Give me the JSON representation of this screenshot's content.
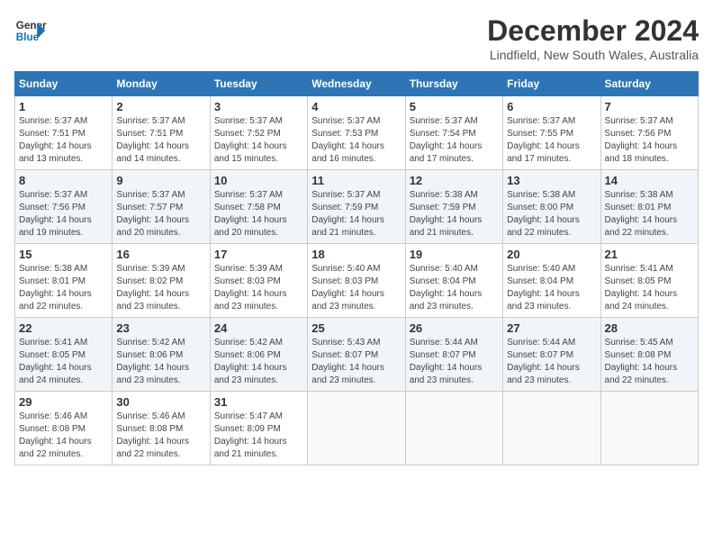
{
  "logo": {
    "line1": "General",
    "line2": "Blue"
  },
  "title": "December 2024",
  "subtitle": "Lindfield, New South Wales, Australia",
  "weekdays": [
    "Sunday",
    "Monday",
    "Tuesday",
    "Wednesday",
    "Thursday",
    "Friday",
    "Saturday"
  ],
  "weeks": [
    [
      {
        "day": "1",
        "sunrise": "5:37 AM",
        "sunset": "7:51 PM",
        "daylight": "14 hours and 13 minutes."
      },
      {
        "day": "2",
        "sunrise": "5:37 AM",
        "sunset": "7:51 PM",
        "daylight": "14 hours and 14 minutes."
      },
      {
        "day": "3",
        "sunrise": "5:37 AM",
        "sunset": "7:52 PM",
        "daylight": "14 hours and 15 minutes."
      },
      {
        "day": "4",
        "sunrise": "5:37 AM",
        "sunset": "7:53 PM",
        "daylight": "14 hours and 16 minutes."
      },
      {
        "day": "5",
        "sunrise": "5:37 AM",
        "sunset": "7:54 PM",
        "daylight": "14 hours and 17 minutes."
      },
      {
        "day": "6",
        "sunrise": "5:37 AM",
        "sunset": "7:55 PM",
        "daylight": "14 hours and 17 minutes."
      },
      {
        "day": "7",
        "sunrise": "5:37 AM",
        "sunset": "7:56 PM",
        "daylight": "14 hours and 18 minutes."
      }
    ],
    [
      {
        "day": "8",
        "sunrise": "5:37 AM",
        "sunset": "7:56 PM",
        "daylight": "14 hours and 19 minutes."
      },
      {
        "day": "9",
        "sunrise": "5:37 AM",
        "sunset": "7:57 PM",
        "daylight": "14 hours and 20 minutes."
      },
      {
        "day": "10",
        "sunrise": "5:37 AM",
        "sunset": "7:58 PM",
        "daylight": "14 hours and 20 minutes."
      },
      {
        "day": "11",
        "sunrise": "5:37 AM",
        "sunset": "7:59 PM",
        "daylight": "14 hours and 21 minutes."
      },
      {
        "day": "12",
        "sunrise": "5:38 AM",
        "sunset": "7:59 PM",
        "daylight": "14 hours and 21 minutes."
      },
      {
        "day": "13",
        "sunrise": "5:38 AM",
        "sunset": "8:00 PM",
        "daylight": "14 hours and 22 minutes."
      },
      {
        "day": "14",
        "sunrise": "5:38 AM",
        "sunset": "8:01 PM",
        "daylight": "14 hours and 22 minutes."
      }
    ],
    [
      {
        "day": "15",
        "sunrise": "5:38 AM",
        "sunset": "8:01 PM",
        "daylight": "14 hours and 22 minutes."
      },
      {
        "day": "16",
        "sunrise": "5:39 AM",
        "sunset": "8:02 PM",
        "daylight": "14 hours and 23 minutes."
      },
      {
        "day": "17",
        "sunrise": "5:39 AM",
        "sunset": "8:03 PM",
        "daylight": "14 hours and 23 minutes."
      },
      {
        "day": "18",
        "sunrise": "5:40 AM",
        "sunset": "8:03 PM",
        "daylight": "14 hours and 23 minutes."
      },
      {
        "day": "19",
        "sunrise": "5:40 AM",
        "sunset": "8:04 PM",
        "daylight": "14 hours and 23 minutes."
      },
      {
        "day": "20",
        "sunrise": "5:40 AM",
        "sunset": "8:04 PM",
        "daylight": "14 hours and 23 minutes."
      },
      {
        "day": "21",
        "sunrise": "5:41 AM",
        "sunset": "8:05 PM",
        "daylight": "14 hours and 24 minutes."
      }
    ],
    [
      {
        "day": "22",
        "sunrise": "5:41 AM",
        "sunset": "8:05 PM",
        "daylight": "14 hours and 24 minutes."
      },
      {
        "day": "23",
        "sunrise": "5:42 AM",
        "sunset": "8:06 PM",
        "daylight": "14 hours and 23 minutes."
      },
      {
        "day": "24",
        "sunrise": "5:42 AM",
        "sunset": "8:06 PM",
        "daylight": "14 hours and 23 minutes."
      },
      {
        "day": "25",
        "sunrise": "5:43 AM",
        "sunset": "8:07 PM",
        "daylight": "14 hours and 23 minutes."
      },
      {
        "day": "26",
        "sunrise": "5:44 AM",
        "sunset": "8:07 PM",
        "daylight": "14 hours and 23 minutes."
      },
      {
        "day": "27",
        "sunrise": "5:44 AM",
        "sunset": "8:07 PM",
        "daylight": "14 hours and 23 minutes."
      },
      {
        "day": "28",
        "sunrise": "5:45 AM",
        "sunset": "8:08 PM",
        "daylight": "14 hours and 22 minutes."
      }
    ],
    [
      {
        "day": "29",
        "sunrise": "5:46 AM",
        "sunset": "8:08 PM",
        "daylight": "14 hours and 22 minutes."
      },
      {
        "day": "30",
        "sunrise": "5:46 AM",
        "sunset": "8:08 PM",
        "daylight": "14 hours and 22 minutes."
      },
      {
        "day": "31",
        "sunrise": "5:47 AM",
        "sunset": "8:09 PM",
        "daylight": "14 hours and 21 minutes."
      },
      null,
      null,
      null,
      null
    ]
  ]
}
